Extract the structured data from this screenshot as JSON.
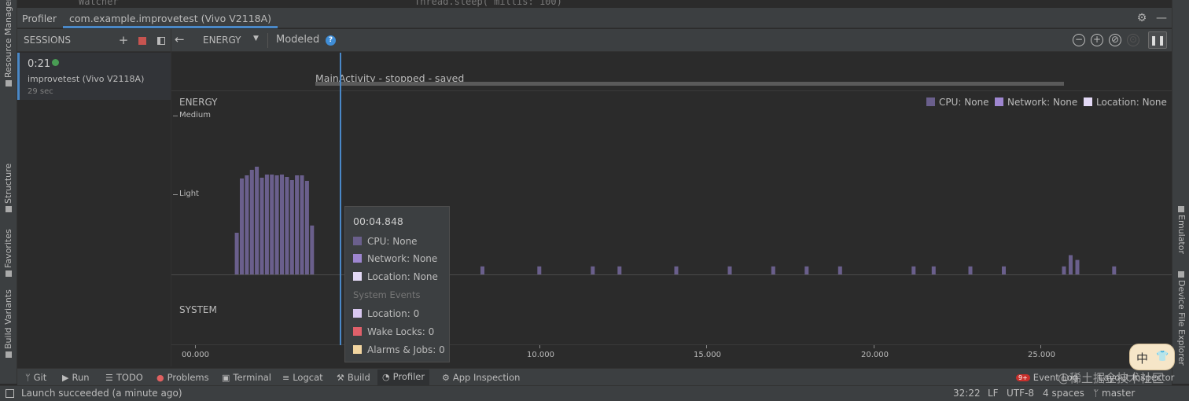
{
  "window": {
    "tool_title": "Profiler",
    "device_tab": "com.example.improvetest (Vivo V2118A)"
  },
  "top_ghost": {
    "left": "Watcher",
    "code": "Thread.sleep( millis: 100)"
  },
  "left_strip": {
    "resource_manager": "Resource Manager",
    "structure": "Structure",
    "favorites": "Favorites",
    "build_variants": "Build Variants"
  },
  "right_strip": {
    "emulator": "Emulator",
    "device_file_explorer": "Device File Explorer"
  },
  "sessions": {
    "header": "SESSIONS",
    "item": {
      "time": "0:21",
      "name": "improvetest (Vivo V2118A)",
      "duration": "29 sec"
    }
  },
  "toolbar": {
    "stage": "ENERGY",
    "mode": "Modeled",
    "help": "?"
  },
  "activity": {
    "label": "MainActivity - stopped - saved"
  },
  "energy": {
    "section": "ENERGY",
    "y_labels": [
      "Medium",
      "Light"
    ],
    "legend": [
      {
        "label": "CPU: None",
        "color": "#6a5f8c"
      },
      {
        "label": "Network: None",
        "color": "#9e86d0"
      },
      {
        "label": "Location: None",
        "color": "#e3d9f5"
      }
    ]
  },
  "system": {
    "section": "SYSTEM"
  },
  "axis": {
    "ticks": [
      "00.000",
      "10.000",
      "15.000",
      "20.000",
      "25.000"
    ]
  },
  "chart_data": {
    "type": "bar",
    "title": "",
    "y_levels": [
      "None",
      "Light",
      "Medium"
    ],
    "x_unit": "seconds",
    "xlim": [
      0,
      28.0
    ],
    "series": [
      {
        "name": "CPU",
        "x": [
          1.25,
          1.4,
          1.55,
          1.7,
          1.85,
          2.0,
          2.15,
          2.3,
          2.45,
          2.6,
          2.75,
          2.9,
          3.05,
          3.2,
          3.35,
          3.5,
          8.6,
          10.3,
          11.9,
          12.7,
          14.4,
          16.0,
          17.3,
          18.3,
          19.3,
          21.5,
          22.1,
          23.2,
          24.2,
          26.0,
          26.2,
          26.4,
          27.5
        ],
        "values": [
          0.52,
          1.2,
          1.24,
          1.31,
          1.35,
          1.21,
          1.25,
          1.25,
          1.24,
          1.25,
          1.22,
          1.18,
          1.24,
          1.24,
          1.17,
          0.61,
          0.1,
          0.1,
          0.1,
          0.1,
          0.1,
          0.1,
          0.1,
          0.1,
          0.1,
          0.1,
          0.1,
          0.1,
          0.1,
          0.1,
          0.24,
          0.18,
          0.1
        ]
      }
    ]
  },
  "tooltip": {
    "time": "00:04.848",
    "cpu": "CPU: None",
    "network": "Network: None",
    "location": "Location: None",
    "system_events": "System Events",
    "location_events": "Location: 0",
    "wake_locks": "Wake Locks: 0",
    "alarms_jobs": "Alarms & Jobs: 0",
    "colors": {
      "cpu": "#6a5f8c",
      "network": "#9e86d0",
      "location": "#e3d9f5",
      "location_events": "#d9c8f0",
      "wake_locks": "#e0606a",
      "alarms": "#f2d5a0"
    }
  },
  "bottom_tabs": {
    "git": "Git",
    "run": "Run",
    "todo": "TODO",
    "problems": "Problems",
    "terminal": "Terminal",
    "logcat": "Logcat",
    "build": "Build",
    "profiler": "Profiler",
    "app_inspection": "App Inspection",
    "event_log": "Event Log",
    "layout_inspector": "Layout Inspector",
    "badge": "9+"
  },
  "status": {
    "message": "Launch succeeded (a minute ago)",
    "position": "32:22",
    "line_sep": "LF",
    "encoding": "UTF-8",
    "indent": "4 spaces",
    "branch": "master"
  },
  "overlay": {
    "ime_1": "中",
    "ime_2": "👕",
    "watermark": "@稀土掘金技术社区"
  }
}
